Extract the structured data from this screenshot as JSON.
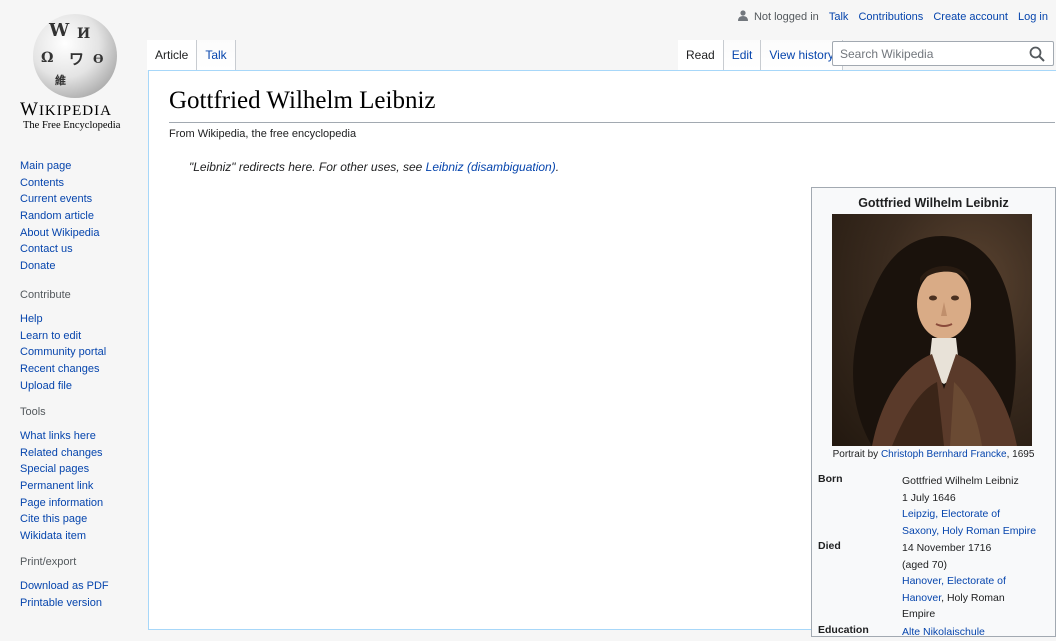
{
  "logo": {
    "wordmark": "Wikipedia",
    "tagline": "The Free Encyclopedia"
  },
  "personal": {
    "not_logged": "Not logged in",
    "talk": "Talk",
    "contributions": "Contributions",
    "create_account": "Create account",
    "login": "Log in"
  },
  "tabs": {
    "article": "Article",
    "talk": "Talk",
    "read": "Read",
    "edit": "Edit",
    "history": "View history"
  },
  "search": {
    "placeholder": "Search Wikipedia"
  },
  "sidebar": {
    "main": [
      "Main page",
      "Contents",
      "Current events",
      "Random article",
      "About Wikipedia",
      "Contact us",
      "Donate"
    ],
    "contribute_head": "Contribute",
    "contribute": [
      "Help",
      "Learn to edit",
      "Community portal",
      "Recent changes",
      "Upload file"
    ],
    "tools_head": "Tools",
    "tools": [
      "What links here",
      "Related changes",
      "Special pages",
      "Permanent link",
      "Page information",
      "Cite this page",
      "Wikidata item"
    ],
    "print_head": "Print/export",
    "print": [
      "Download as PDF",
      "Printable version"
    ]
  },
  "article": {
    "title": "Gottfried Wilhelm Leibniz",
    "sitesub": "From Wikipedia, the free encyclopedia",
    "hatnote_text": "\"Leibniz\" redirects here. For other uses, see ",
    "hatnote_link": "Leibniz (disambiguation)",
    "hatnote_end": "."
  },
  "infobox": {
    "title": "Gottfried Wilhelm Leibniz",
    "caption_prefix": "Portrait by ",
    "caption_link": "Christoph Bernhard Francke",
    "caption_suffix": ", 1695",
    "born_label": "Born",
    "born_name": "Gottfried Wilhelm Leibniz",
    "born_date": "1 July 1646",
    "born_place_1": "Leipzig",
    "born_place_2": ", Electorate of",
    "born_place_3": "Saxony",
    "born_place_4": ", Holy Roman Empire",
    "died_label": "Died",
    "died_date": "14 November 1716",
    "died_age": "(aged 70)",
    "died_place_1": "Hanover",
    "died_place_2": ", Electorate of",
    "died_place_3": "Hanover",
    "died_place_4": ", Holy Roman",
    "died_place_5": "Empire",
    "education_label": "Education",
    "education_value": "Alte Nikolaischule"
  }
}
